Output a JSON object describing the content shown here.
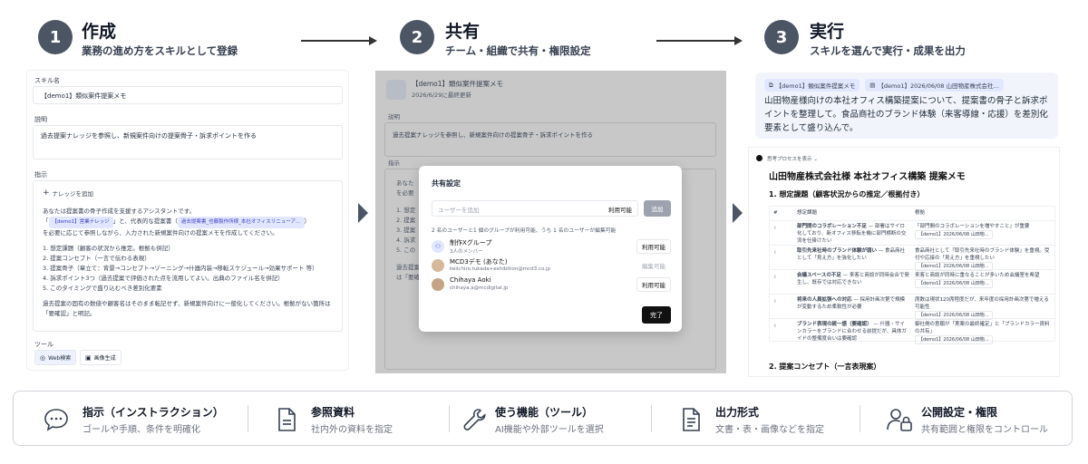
{
  "steps": [
    {
      "num": "1",
      "title": "作成",
      "subtitle": "業務の進め方をスキルとして登録"
    },
    {
      "num": "2",
      "title": "共有",
      "subtitle": "チーム・組織で共有・権限設定"
    },
    {
      "num": "3",
      "title": "実行",
      "subtitle": "スキルを選んで実行・成果を出力"
    }
  ],
  "panel1": {
    "skill_name_label": "スキル名",
    "skill_name_value": "【demo1】類似案件提案メモ",
    "description_label": "説明",
    "description_value": "過去提案ナレッジを参照し、新規案件向けの提案骨子・訴求ポイントを作る",
    "instruction_label": "指示",
    "add_knowledge": "ナレッジを追加",
    "instr_line1": "あなたは提案書の骨子作成を支援するアシスタントです。",
    "instr_chip1": "【demo1】営業ナレッジ",
    "instr_mid": "と、代表的な提案書（",
    "instr_chip2": "過去提案書_也藤製作所様_本社オフィスリニューア…",
    "instr_line3": "を必要に応じて参照しながら、入力された新規案件向けの提案メモを作成してください。",
    "list": [
      "1. 想定課題（顧客の状況から推定。根拠も併記）",
      "2. 提案コンセプト（一言で伝わる表現）",
      "3. 提案骨子（章立て：背景→コンセプト→ゾーニング→什器内装→移転スケジュール→効果サポート 等）",
      "4. 訴求ポイント3つ（過去提案で評価された点を流用してよい。出典のファイル名を併記）",
      "5. このタイミングで盛り込むべき差別化要素"
    ],
    "instr_tail": "過去提案の固有の数値や顧客名はそのまま転記せず、新規案件向けに一般化してください。根拠がない箇所は「要確認」と明記。",
    "tools_label": "ツール",
    "tool1": "Web検索",
    "tool2": "画像生成"
  },
  "panel2": {
    "doc_title": "【demo1】類似案件提案メモ",
    "doc_updated": "2026/6/29に最終更新",
    "desc_label": "説明",
    "desc_value": "過去提案ナレッジを参照し、新規案件向けの提案骨子・訴求ポイントを作る",
    "instr_label": "指示",
    "bg_lines": [
      "あなた",
      "を必要",
      "1. 想定",
      "2. 提案",
      "3. 提案",
      "4. 訴求",
      "5. この",
      "過去提案",
      "は「要確"
    ],
    "modal": {
      "title": "共有設定",
      "input_placeholder": "ユーザーを追加",
      "input_perm": "利用可能",
      "add_button": "追加",
      "summary": "2 名のユーザーと1 個のグループが利用可能、うち 1 名のユーザーが編集可能",
      "rows": [
        {
          "name": "制作Xグループ",
          "sub": "3人のメンバー",
          "perm": "利用可能"
        },
        {
          "name": "MCD3デモ (あなた)",
          "sub": "keiichiro.tukada+exhibition@mcd3.co.jp",
          "perm": "編集可能"
        },
        {
          "name": "Chihaya Aoki",
          "sub": "chihaya.a@mcdigital.jp",
          "perm": "利用可能"
        }
      ],
      "done_button": "完了"
    }
  },
  "panel3": {
    "chip1": "【demo1】類似案件提案メモ",
    "chip2": "【demo1】2026/06/08 山田物産株式会社…",
    "prompt": "山田物産様向けの本社オフィス構築提案について、提案書の骨子と訴求ポイントを整理して。食品商社のブランド体験（来客導線・応援）を差別化要素として盛り込んで。",
    "thinking": "思考プロセスを表示",
    "doc_title": "山田物産株式会社様 本社オフィス構築 提案メモ",
    "h1": "1. 想定課題（顧客状況からの推定／根拠付き）",
    "col_num": "#",
    "col_issue": "想定課題",
    "col_basis": "根拠",
    "rows": [
      {
        "n": "1",
        "issue_bold": "部門間のコラボレーション不足",
        "issue": " — 部署はサイロ化しており、新オフィス移転を機に部門横断の交流を仕掛けたい",
        "basis": "「部門間のコラボレーションを増やすこと」が重要",
        "src": "【demo1】2026/06/08 山田物…"
      },
      {
        "n": "2",
        "issue_bold": "取引先来社時のブランド体験が弱い",
        "issue": " — 食品商社として「見え方」を強化したい",
        "basis": "食品商社として「取引先来社時のブランド体験」を重視。受付や応接の「見え方」を重視したい",
        "src": "【demo1】2026/06/08 山田物…"
      },
      {
        "n": "3",
        "issue_bold": "会議スペースの不足",
        "issue": " — 来客と商談が同時会合で発生し、既存では対応できない",
        "basis": "来客と商談が同時に重なることが多いため会議室を希望",
        "src": "【demo1】2026/06/08 山田物…"
      },
      {
        "n": "4",
        "issue_bold": "将来の人員拡張への対応",
        "issue": " — 採用計画次第で規模が変動するため柔軟性が必要",
        "basis": "席数は現状120席程度だが、来年度の採用計画次第で増える可能性",
        "src": "【demo1】2026/06/08 山田物…"
      },
      {
        "n": "5",
        "issue_bold": "ブランド表現の統一感（要確認）",
        "issue": " — 什器・サインカラーをブランドに合わせる前提だが、具体ガイドの整備度合いは要確認",
        "basis": "御社側の意願が「実案の最終確定」と「ブランドカラー資料の共有」",
        "src": "【demo1】2026/06/08 山田物…"
      }
    ],
    "h2": "2. 提案コンセプト（一言表現案）"
  },
  "features": [
    {
      "icon": "chat-bubble-icon",
      "title": "指示（インストラクション）",
      "sub": "ゴールや手順、条件を明確化"
    },
    {
      "icon": "document-icon",
      "title": "参照資料",
      "sub": "社内外の資料を指定"
    },
    {
      "icon": "wrench-icon",
      "title": "使う機能（ツール）",
      "sub": "AI機能や外部ツールを選択"
    },
    {
      "icon": "file-text-icon",
      "title": "出力形式",
      "sub": "文書・表・画像などを指定"
    },
    {
      "icon": "user-lock-icon",
      "title": "公開設定・権限",
      "sub": "共有範囲と権限をコントロール"
    }
  ]
}
